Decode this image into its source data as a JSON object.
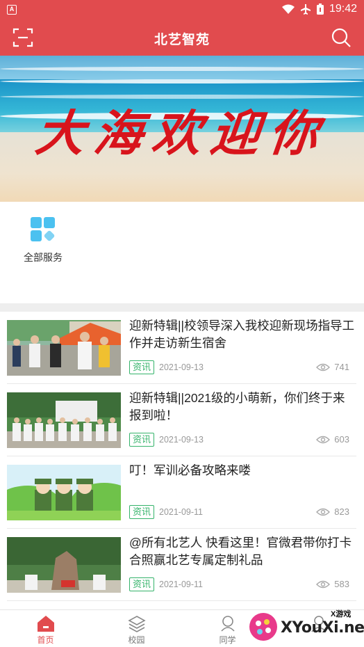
{
  "status_bar": {
    "time": "19:42"
  },
  "header": {
    "title": "北艺智苑"
  },
  "banner": {
    "text": "大海欢迎你"
  },
  "services": [
    {
      "label": "全部服务"
    }
  ],
  "news": [
    {
      "title": "迎新特辑||校领导深入我校迎新现场指导工作并走访新生宿舍",
      "tag": "资讯",
      "date": "2021-09-13",
      "views": "741"
    },
    {
      "title": "迎新特辑||2021级的小萌新，你们终于来报到啦！",
      "tag": "资讯",
      "date": "2021-09-13",
      "views": "603"
    },
    {
      "title": "叮！军训必备攻略来喽",
      "tag": "资讯",
      "date": "2021-09-11",
      "views": "823"
    },
    {
      "title": "@所有北艺人 快看这里！官微君带你打卡合照赢北艺专属定制礼品",
      "tag": "资讯",
      "date": "2021-09-11",
      "views": "583"
    }
  ],
  "tabs": [
    {
      "label": "首页",
      "icon": "home-icon"
    },
    {
      "label": "校园",
      "icon": "layers-icon"
    },
    {
      "label": "同学",
      "icon": "people-icon"
    },
    {
      "label": "",
      "icon": "user-icon"
    }
  ],
  "watermark": {
    "text": "XYouXi.net",
    "small": "X游戏"
  },
  "colors": {
    "brand": "#e14b4e",
    "tag": "#34b36a",
    "service_icon": "#4bc1f0"
  }
}
